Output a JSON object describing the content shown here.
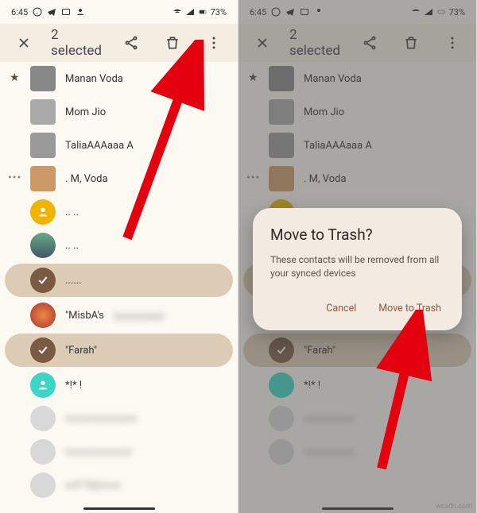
{
  "status": {
    "time": "6:45",
    "battery": "73%"
  },
  "selectionBar": {
    "title": "2 selected"
  },
  "contacts": [
    {
      "name": "Manan Voda",
      "avatar_type": "square",
      "avatar_color": "#888"
    },
    {
      "name": "Mom Jio",
      "avatar_type": "square",
      "avatar_color": "#aaa"
    },
    {
      "name": "TaliaAAAaaa A",
      "avatar_type": "square",
      "avatar_color": "#999"
    },
    {
      "name": ". M, Voda",
      "avatar_type": "square",
      "avatar_color": "#cc9966"
    },
    {
      "name": ".. ..",
      "avatar_type": "circle",
      "avatar_color": "#f0b400"
    },
    {
      "name": ".. ..",
      "avatar_type": "photo",
      "avatar_color": "#8a6a5a"
    },
    {
      "name": "......",
      "avatar_type": "selected",
      "avatar_color": "#7b5a44"
    },
    {
      "name": "\"MisbA's",
      "avatar_type": "photo",
      "avatar_color": "#cc5533"
    },
    {
      "name": "\"Farah\"",
      "avatar_type": "selected",
      "avatar_color": "#7b5a44"
    },
    {
      "name": "*!* !",
      "avatar_type": "circle",
      "avatar_color": "#3dd6c4"
    },
    {
      "name": "blurred",
      "avatar_type": "circle",
      "avatar_color": "#d8d8d8"
    },
    {
      "name": "blurred",
      "avatar_type": "square",
      "avatar_color": "#d8d8d8"
    }
  ],
  "dialog": {
    "title": "Move to Trash?",
    "body": "These contacts will be removed from all your synced devices",
    "cancel": "Cancel",
    "confirm": "Move to Trash"
  },
  "watermark": "wsxdn.com"
}
